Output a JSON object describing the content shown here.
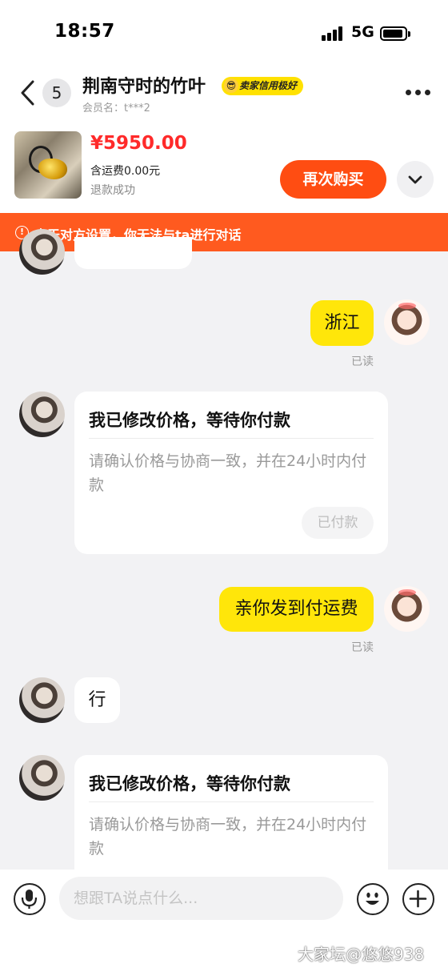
{
  "status_bar": {
    "time": "18:57",
    "network": "5G"
  },
  "header": {
    "unread_count": "5",
    "shop_name": "荆南守时的竹叶",
    "credit_badge": "卖家信用极好",
    "member_label": "会员名：t***2"
  },
  "order": {
    "price": "¥5950.00",
    "shipping": "含运费0.00元",
    "status": "退款成功",
    "rebuy_label": "再次购买"
  },
  "notice": {
    "text": "由于对方设置，你无法与ta进行对话"
  },
  "messages": {
    "m1": {
      "text": "浙江",
      "read": "已读"
    },
    "m2": {
      "title": "我已修改价格，等待你付款",
      "desc": "请确认价格与协商一致，并在24小时内付款",
      "button": "已付款"
    },
    "m3": {
      "text": "亲你发到付运费",
      "read": "已读"
    },
    "m4": {
      "text": "行"
    },
    "m5": {
      "title": "我已修改价格，等待你付款",
      "desc": "请确认价格与协商一致，并在24小时内付款"
    }
  },
  "composer": {
    "placeholder": "想跟TA说点什么..."
  },
  "watermark": "大家坛@悠悠938",
  "colors": {
    "accent_orange": "#ff4d12",
    "notice_bg": "#ff5a1f",
    "bubble_yellow": "#ffe60a",
    "price_red": "#ff2a2a"
  },
  "icons": [
    "back-arrow-icon",
    "more-icon",
    "chevron-down-icon",
    "alert-icon",
    "microphone-icon",
    "emoji-icon",
    "plus-icon"
  ]
}
